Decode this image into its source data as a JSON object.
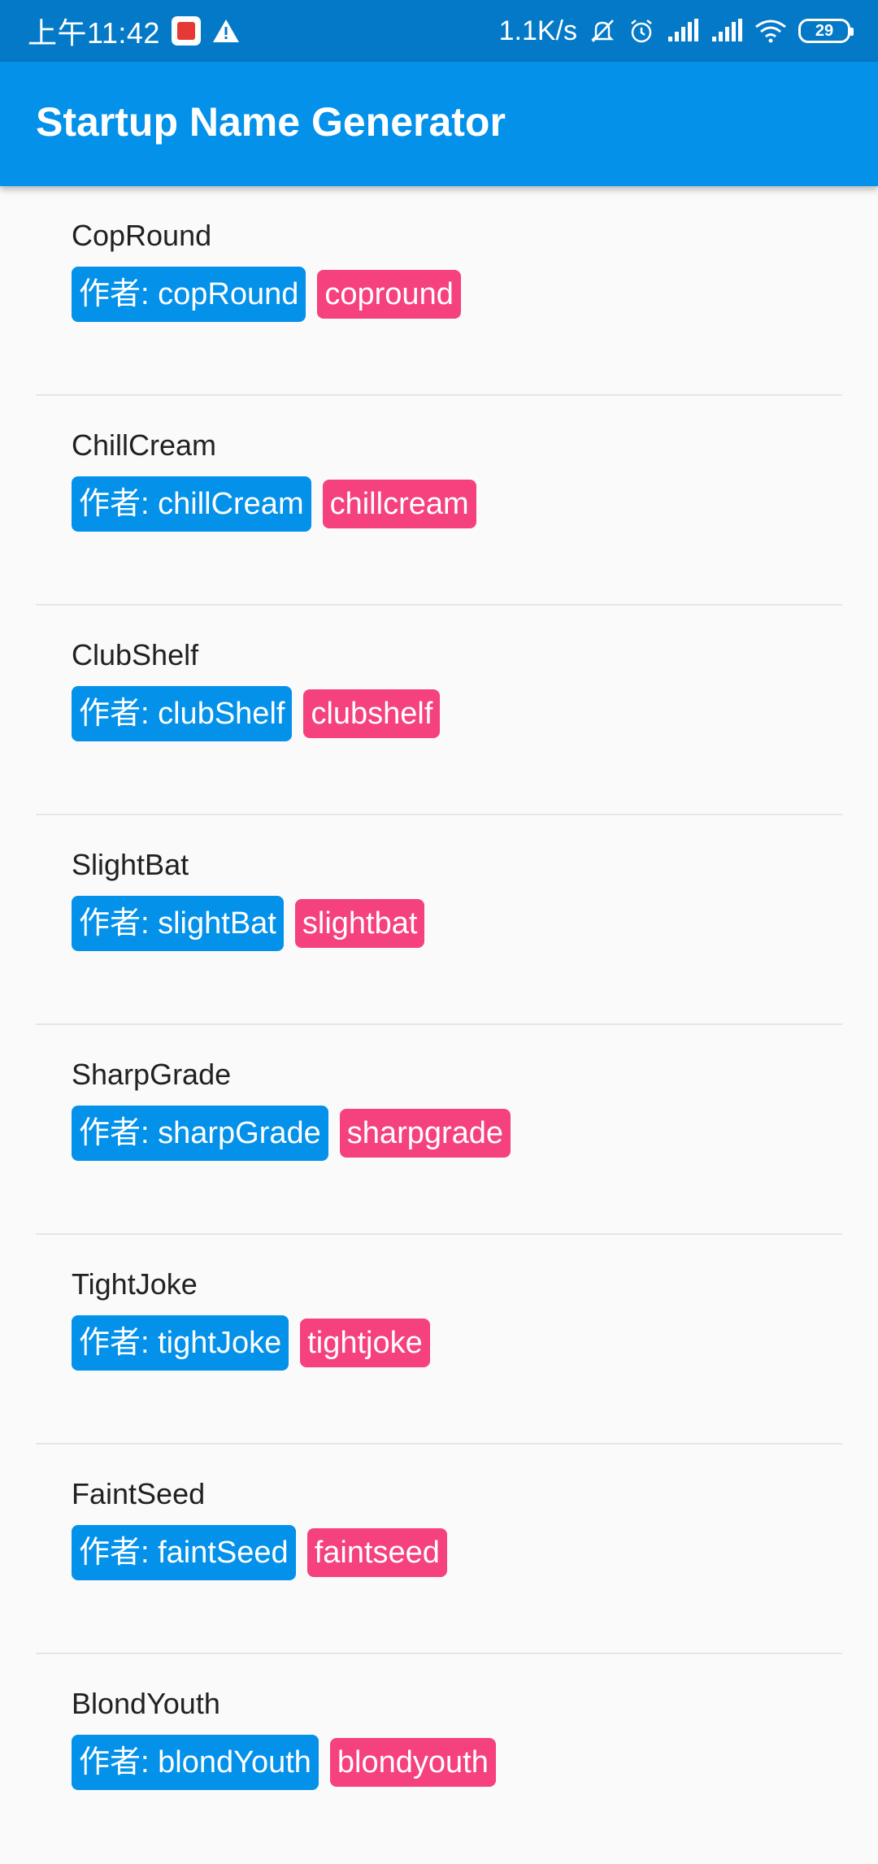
{
  "status_bar": {
    "time": "上午11:42",
    "network_speed": "1.1K/s",
    "battery_level": "29",
    "icons": [
      "app-notification-icon",
      "warning-icon",
      "mute-icon",
      "alarm-icon",
      "signal-icon",
      "signal-icon",
      "wifi-icon",
      "battery-icon"
    ]
  },
  "app_bar": {
    "title": "Startup Name Generator"
  },
  "colors": {
    "status_bar": "#0379c7",
    "primary": "#0391ea",
    "accent": "#f5417d"
  },
  "items": [
    {
      "name": "CopRound",
      "author": "作者: copRound",
      "tag": "copround"
    },
    {
      "name": "ChillCream",
      "author": "作者: chillCream",
      "tag": "chillcream"
    },
    {
      "name": "ClubShelf",
      "author": "作者: clubShelf",
      "tag": "clubshelf"
    },
    {
      "name": "SlightBat",
      "author": "作者: slightBat",
      "tag": "slightbat"
    },
    {
      "name": "SharpGrade",
      "author": "作者: sharpGrade",
      "tag": "sharpgrade"
    },
    {
      "name": "TightJoke",
      "author": "作者: tightJoke",
      "tag": "tightjoke"
    },
    {
      "name": "FaintSeed",
      "author": "作者: faintSeed",
      "tag": "faintseed"
    },
    {
      "name": "BlondYouth",
      "author": "作者: blondYouth",
      "tag": "blondyouth"
    }
  ]
}
